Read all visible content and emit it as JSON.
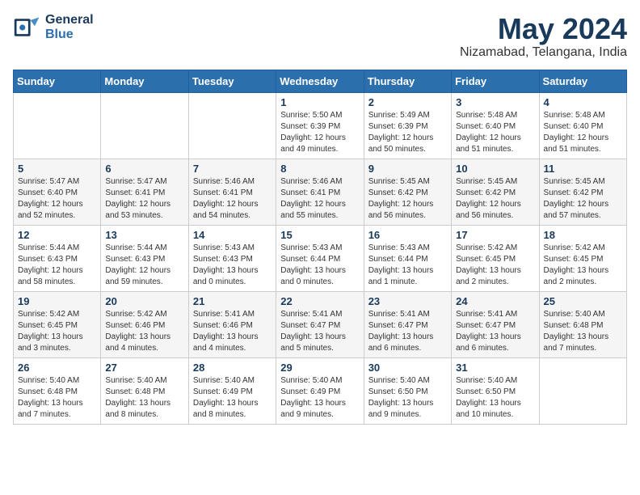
{
  "logo": {
    "general": "General",
    "blue": "Blue"
  },
  "title": "May 2024",
  "location": "Nizamabad, Telangana, India",
  "days_of_week": [
    "Sunday",
    "Monday",
    "Tuesday",
    "Wednesday",
    "Thursday",
    "Friday",
    "Saturday"
  ],
  "weeks": [
    [
      {
        "day": "",
        "info": ""
      },
      {
        "day": "",
        "info": ""
      },
      {
        "day": "",
        "info": ""
      },
      {
        "day": "1",
        "info": "Sunrise: 5:50 AM\nSunset: 6:39 PM\nDaylight: 12 hours\nand 49 minutes."
      },
      {
        "day": "2",
        "info": "Sunrise: 5:49 AM\nSunset: 6:39 PM\nDaylight: 12 hours\nand 50 minutes."
      },
      {
        "day": "3",
        "info": "Sunrise: 5:48 AM\nSunset: 6:40 PM\nDaylight: 12 hours\nand 51 minutes."
      },
      {
        "day": "4",
        "info": "Sunrise: 5:48 AM\nSunset: 6:40 PM\nDaylight: 12 hours\nand 51 minutes."
      }
    ],
    [
      {
        "day": "5",
        "info": "Sunrise: 5:47 AM\nSunset: 6:40 PM\nDaylight: 12 hours\nand 52 minutes."
      },
      {
        "day": "6",
        "info": "Sunrise: 5:47 AM\nSunset: 6:41 PM\nDaylight: 12 hours\nand 53 minutes."
      },
      {
        "day": "7",
        "info": "Sunrise: 5:46 AM\nSunset: 6:41 PM\nDaylight: 12 hours\nand 54 minutes."
      },
      {
        "day": "8",
        "info": "Sunrise: 5:46 AM\nSunset: 6:41 PM\nDaylight: 12 hours\nand 55 minutes."
      },
      {
        "day": "9",
        "info": "Sunrise: 5:45 AM\nSunset: 6:42 PM\nDaylight: 12 hours\nand 56 minutes."
      },
      {
        "day": "10",
        "info": "Sunrise: 5:45 AM\nSunset: 6:42 PM\nDaylight: 12 hours\nand 56 minutes."
      },
      {
        "day": "11",
        "info": "Sunrise: 5:45 AM\nSunset: 6:42 PM\nDaylight: 12 hours\nand 57 minutes."
      }
    ],
    [
      {
        "day": "12",
        "info": "Sunrise: 5:44 AM\nSunset: 6:43 PM\nDaylight: 12 hours\nand 58 minutes."
      },
      {
        "day": "13",
        "info": "Sunrise: 5:44 AM\nSunset: 6:43 PM\nDaylight: 12 hours\nand 59 minutes."
      },
      {
        "day": "14",
        "info": "Sunrise: 5:43 AM\nSunset: 6:43 PM\nDaylight: 13 hours\nand 0 minutes."
      },
      {
        "day": "15",
        "info": "Sunrise: 5:43 AM\nSunset: 6:44 PM\nDaylight: 13 hours\nand 0 minutes."
      },
      {
        "day": "16",
        "info": "Sunrise: 5:43 AM\nSunset: 6:44 PM\nDaylight: 13 hours\nand 1 minute."
      },
      {
        "day": "17",
        "info": "Sunrise: 5:42 AM\nSunset: 6:45 PM\nDaylight: 13 hours\nand 2 minutes."
      },
      {
        "day": "18",
        "info": "Sunrise: 5:42 AM\nSunset: 6:45 PM\nDaylight: 13 hours\nand 2 minutes."
      }
    ],
    [
      {
        "day": "19",
        "info": "Sunrise: 5:42 AM\nSunset: 6:45 PM\nDaylight: 13 hours\nand 3 minutes."
      },
      {
        "day": "20",
        "info": "Sunrise: 5:42 AM\nSunset: 6:46 PM\nDaylight: 13 hours\nand 4 minutes."
      },
      {
        "day": "21",
        "info": "Sunrise: 5:41 AM\nSunset: 6:46 PM\nDaylight: 13 hours\nand 4 minutes."
      },
      {
        "day": "22",
        "info": "Sunrise: 5:41 AM\nSunset: 6:47 PM\nDaylight: 13 hours\nand 5 minutes."
      },
      {
        "day": "23",
        "info": "Sunrise: 5:41 AM\nSunset: 6:47 PM\nDaylight: 13 hours\nand 6 minutes."
      },
      {
        "day": "24",
        "info": "Sunrise: 5:41 AM\nSunset: 6:47 PM\nDaylight: 13 hours\nand 6 minutes."
      },
      {
        "day": "25",
        "info": "Sunrise: 5:40 AM\nSunset: 6:48 PM\nDaylight: 13 hours\nand 7 minutes."
      }
    ],
    [
      {
        "day": "26",
        "info": "Sunrise: 5:40 AM\nSunset: 6:48 PM\nDaylight: 13 hours\nand 7 minutes."
      },
      {
        "day": "27",
        "info": "Sunrise: 5:40 AM\nSunset: 6:48 PM\nDaylight: 13 hours\nand 8 minutes."
      },
      {
        "day": "28",
        "info": "Sunrise: 5:40 AM\nSunset: 6:49 PM\nDaylight: 13 hours\nand 8 minutes."
      },
      {
        "day": "29",
        "info": "Sunrise: 5:40 AM\nSunset: 6:49 PM\nDaylight: 13 hours\nand 9 minutes."
      },
      {
        "day": "30",
        "info": "Sunrise: 5:40 AM\nSunset: 6:50 PM\nDaylight: 13 hours\nand 9 minutes."
      },
      {
        "day": "31",
        "info": "Sunrise: 5:40 AM\nSunset: 6:50 PM\nDaylight: 13 hours\nand 10 minutes."
      },
      {
        "day": "",
        "info": ""
      }
    ]
  ]
}
